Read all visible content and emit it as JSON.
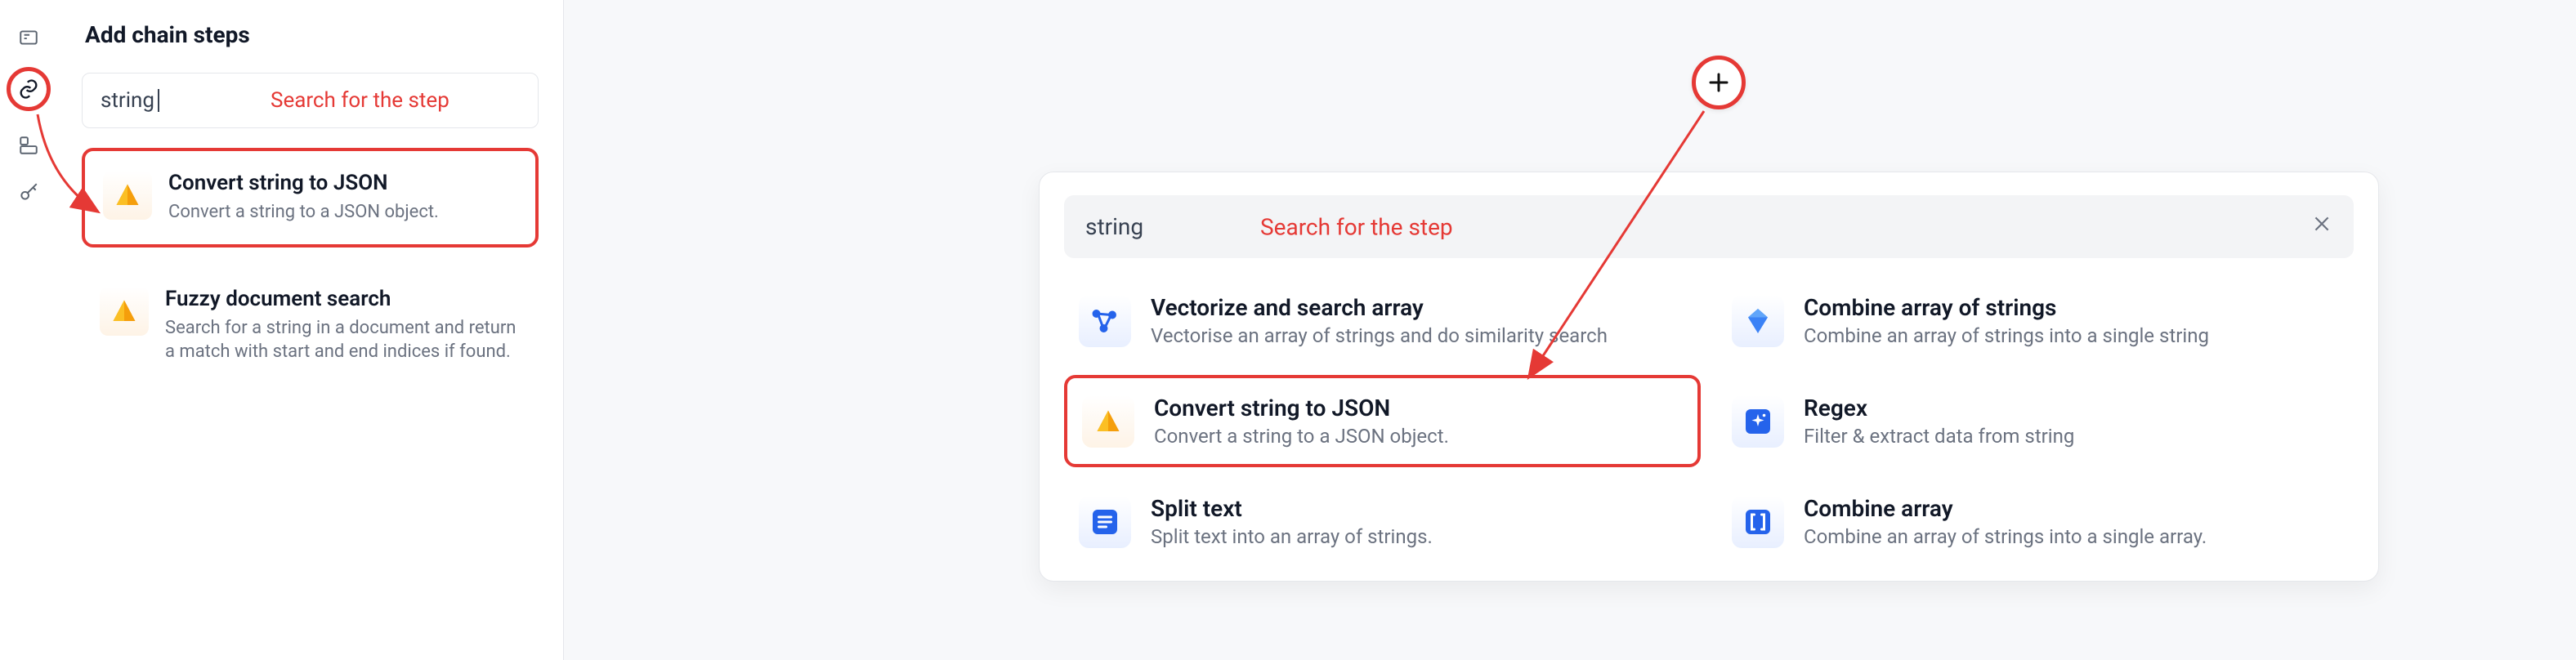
{
  "rail": {
    "icons": [
      "form-icon",
      "chain-icon",
      "layout-icon",
      "key-icon"
    ]
  },
  "left": {
    "title": "Add chain steps",
    "search_value": "string",
    "search_annotation": "Search for the step",
    "items": [
      {
        "title": "Convert string to JSON",
        "desc": "Convert a string to a JSON object.",
        "icon": "pyramid",
        "highlight": true
      },
      {
        "title": "Fuzzy document search",
        "desc": "Search for a string in a document and return a match with start and end indices if found.",
        "icon": "pyramid",
        "highlight": false
      }
    ]
  },
  "plus": {
    "label": "+"
  },
  "popup": {
    "search_value": "string",
    "search_annotation": "Search for the step",
    "items": [
      {
        "title": "Vectorize and search array",
        "desc": "Vectorise an array of strings and do similarity search",
        "icon": "graph",
        "color": "blue",
        "highlight": false
      },
      {
        "title": "Combine array of strings",
        "desc": "Combine an array of strings into a single string",
        "icon": "gem",
        "color": "blue",
        "highlight": false
      },
      {
        "title": "Convert string to JSON",
        "desc": "Convert a string to a JSON object.",
        "icon": "pyramid",
        "color": "orange",
        "highlight": true
      },
      {
        "title": "Regex",
        "desc": "Filter & extract data from string",
        "icon": "sparkle",
        "color": "blue",
        "highlight": false
      },
      {
        "title": "Split text",
        "desc": "Split text into an array of strings.",
        "icon": "lines",
        "color": "blue",
        "highlight": false
      },
      {
        "title": "Combine array",
        "desc": "Combine an array of strings into a single array.",
        "icon": "brackets",
        "color": "blue",
        "highlight": false
      }
    ]
  }
}
